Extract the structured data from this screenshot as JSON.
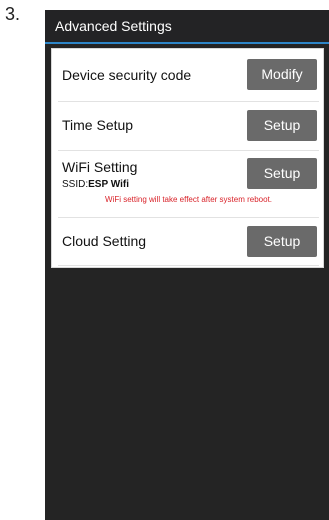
{
  "step_number": "3.",
  "header": {
    "title": "Advanced Settings"
  },
  "settings": {
    "security": {
      "label": "Device security code",
      "button": "Modify"
    },
    "time": {
      "label": "Time Setup",
      "button": "Setup"
    },
    "wifi": {
      "label": "WiFi Setting",
      "ssid_prefix": "SSID:",
      "ssid_value": "ESP Wifi",
      "note": "WiFi setting will take effect after system reboot.",
      "button": "Setup"
    },
    "cloud": {
      "label": "Cloud Setting",
      "button": "Setup"
    }
  },
  "colors": {
    "title_bar": "#232325",
    "title_underline": "#2e86c8",
    "button": "#6a6a6a",
    "note_text": "#d9232a",
    "screen_bg": "#242424"
  }
}
